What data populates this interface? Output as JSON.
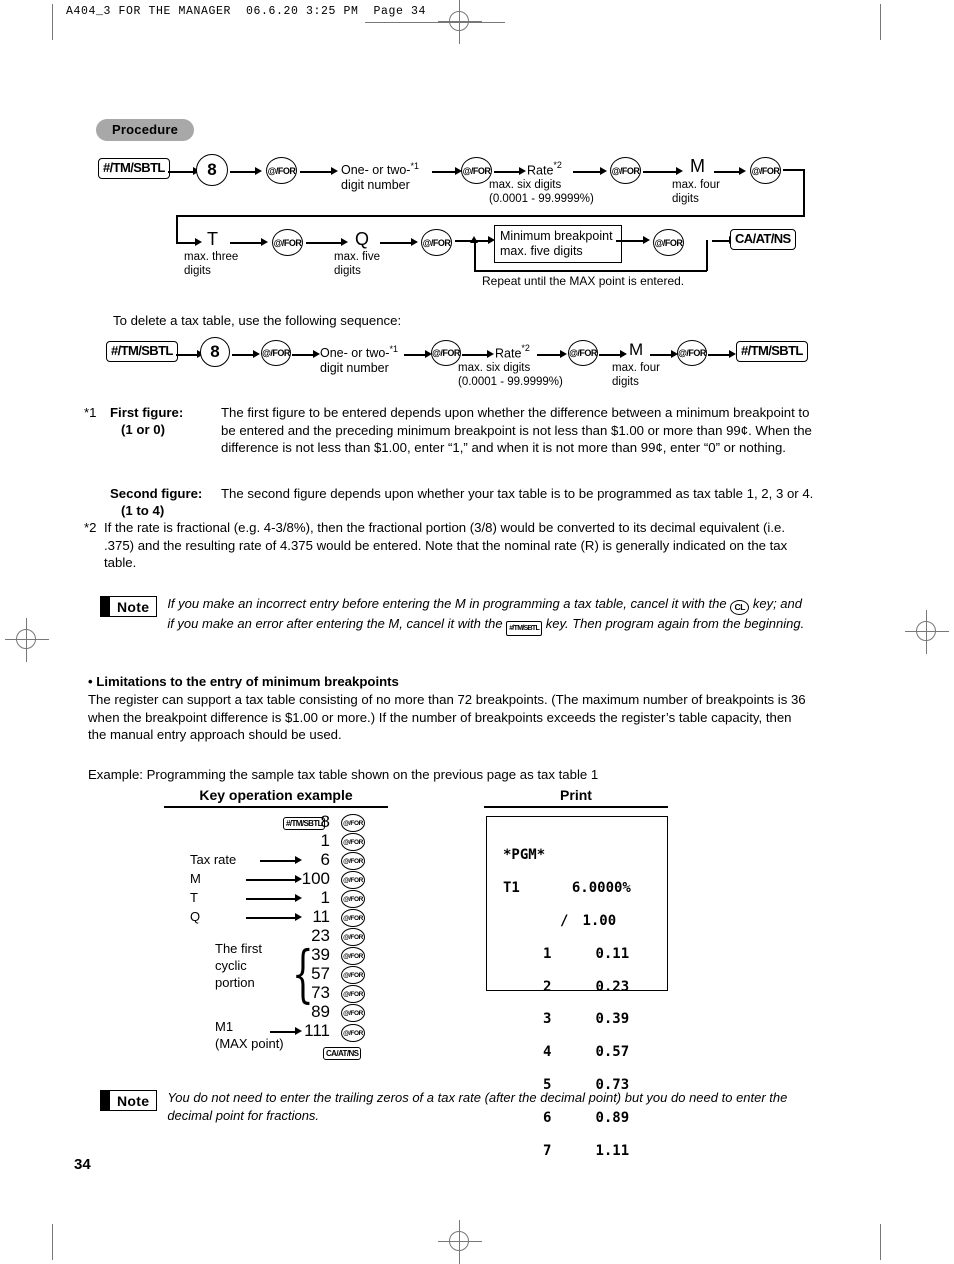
{
  "page": {
    "header": "A404_3 FOR THE MANAGER  06.6.20 3:25 PM  Page 34",
    "number": "34"
  },
  "procedure": {
    "pill_label": "Procedure",
    "row1": {
      "key_sbtl": "#/TM/SBTL",
      "num_8": "8",
      "key_for": "@/FOR",
      "step_number_line1": "One- or two-",
      "step_number_sup": "*1",
      "step_number_line2": "digit number",
      "rate_label": "Rate",
      "rate_sup": "*2",
      "rate_sub1": "max. six digits",
      "rate_sub2": "(0.0001 - 99.9999%)",
      "m_label": "M",
      "m_sub1": "max. four",
      "m_sub2": "digits"
    },
    "row2": {
      "t_label": "T",
      "t_sub1": "max. three",
      "t_sub2": "digits",
      "q_label": "Q",
      "q_sub1": "max. five",
      "q_sub2": "digits",
      "breakpoint_line1": "Minimum breakpoint",
      "breakpoint_line2": "max. five digits",
      "key_for": "@/FOR",
      "key_caatns": "CA/AT/NS",
      "repeat_note": "Repeat until the MAX point is entered."
    }
  },
  "delete": {
    "intro": "To delete a tax table, use the following sequence:",
    "key_sbtl": "#/TM/SBTL",
    "num_8": "8",
    "key_for": "@/FOR",
    "step_number_line1": "One- or two-",
    "step_number_sup": "*1",
    "step_number_line2": "digit number",
    "rate_label": "Rate",
    "rate_sup": "*2",
    "rate_sub1": "max. six digits",
    "rate_sub2": "(0.0001 - 99.9999%)",
    "m_label": "M",
    "m_sub1": "max. four",
    "m_sub2": "digits",
    "key_sbtl_end": "#/TM/SBTL"
  },
  "footnotes": {
    "star1_marker": "*1",
    "first_figure_label": "First figure:",
    "first_figure_range": "(1 or 0)",
    "first_figure_text": "The first figure to be entered depends upon whether the difference between a minimum breakpoint to be entered and the preceding minimum breakpoint is not less than $1.00 or more than 99¢. When the difference is not less than $1.00, enter “1,” and when it is not more than 99¢, enter “0” or nothing.",
    "second_figure_label": "Second figure:",
    "second_figure_range": "(1 to 4)",
    "second_figure_text": "The second figure depends upon whether your tax table is to be programmed as tax table 1, 2, 3 or 4.",
    "star2_marker": "*2",
    "star2_text": "If the rate is fractional (e.g. 4-3/8%), then the fractional portion (3/8) would be converted to its decimal equivalent (i.e. .375) and the resulting rate of 4.375 would be entered. Note that the nominal rate (R) is generally indicated on the tax table."
  },
  "note1": {
    "badge": "Note",
    "text_part1": "If you make an incorrect entry before entering the M in programming a tax table, cancel it with the",
    "key_cl": "CL",
    "text_part2": "key; and if you make an error after entering the M, cancel it with the",
    "key_sbtl": "#/TM/SBTL",
    "text_part3": "key.  Then program again from the beginning."
  },
  "limitations": {
    "heading": "• Limitations to the entry of minimum breakpoints",
    "text": "The register can support a tax table consisting of no more than 72 breakpoints. (The maximum number of breakpoints is 36 when the breakpoint difference is $1.00 or more.) If the number of breakpoints exceeds the register’s table capacity, then the manual entry approach should be used.",
    "example_line": "Example: Programming the sample tax table shown on the previous page as tax table 1"
  },
  "example": {
    "key_column_title": "Key operation example",
    "print_column_title": "Print",
    "key_label": "#/TM/SBTL",
    "for_key": "@/FOR",
    "total_key": "CA/AT/NS",
    "rows": [
      {
        "label": "",
        "arrow": false,
        "value": "8"
      },
      {
        "label": "",
        "arrow": false,
        "value": "1"
      },
      {
        "label": "Tax rate",
        "arrow": true,
        "value": "6"
      },
      {
        "label": "M",
        "arrow": true,
        "value": "100"
      },
      {
        "label": "T",
        "arrow": true,
        "value": "1"
      },
      {
        "label": "Q",
        "arrow": true,
        "value": "11"
      },
      {
        "label": "",
        "arrow": false,
        "value": "23"
      },
      {
        "label": "",
        "arrow": false,
        "value": "39"
      },
      {
        "label": "",
        "arrow": false,
        "value": "57"
      },
      {
        "label": "",
        "arrow": false,
        "value": "73"
      },
      {
        "label": "",
        "arrow": false,
        "value": "89"
      },
      {
        "label": "",
        "arrow": true,
        "value": "111"
      }
    ],
    "brace_label_line1": "The first",
    "brace_label_line2": "cyclic",
    "brace_label_line3": "portion",
    "max_label_line1": "M1",
    "max_label_line2": "(MAX point)"
  },
  "receipt": {
    "title": "*PGM*",
    "table_label": "T1",
    "rate": "6.0000%",
    "breakpoint_marker": "/",
    "breakpoint_value": "1.00",
    "rows": [
      {
        "idx": "1",
        "value": "0.11"
      },
      {
        "idx": "2",
        "value": "0.23"
      },
      {
        "idx": "3",
        "value": "0.39"
      },
      {
        "idx": "4",
        "value": "0.57"
      },
      {
        "idx": "5",
        "value": "0.73"
      },
      {
        "idx": "6",
        "value": "0.89"
      },
      {
        "idx": "7",
        "value": "1.11"
      }
    ]
  },
  "note2": {
    "badge": "Note",
    "text": "You do not need to enter the trailing zeros of a tax rate (after the decimal point) but you do need to enter the decimal point for fractions."
  }
}
